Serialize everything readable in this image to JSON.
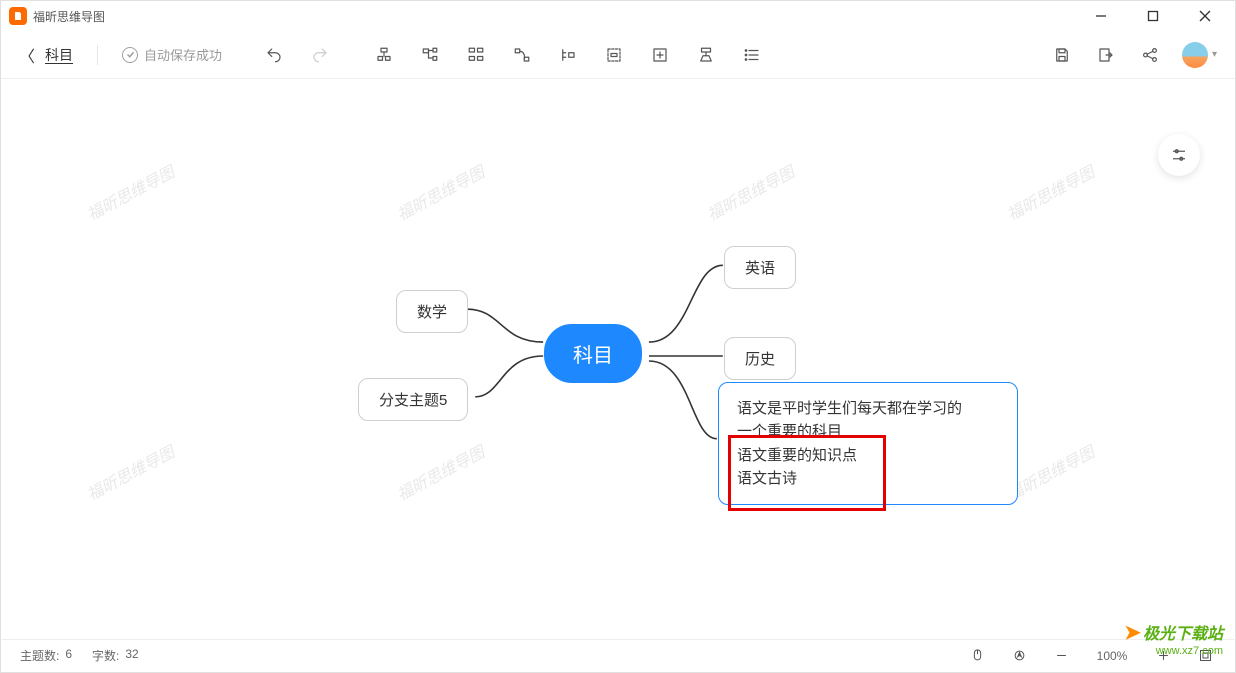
{
  "app": {
    "title": "福昕思维导图"
  },
  "toolbar": {
    "breadcrumb": "科目",
    "autosave_status": "自动保存成功"
  },
  "mindmap": {
    "central": "科目",
    "left_nodes": [
      "数学",
      "分支主题5"
    ],
    "right_nodes": [
      "英语",
      "历史"
    ],
    "note_lines": [
      "语文是平时学生们每天都在学习的",
      "一个重要的科目",
      "语文重要的知识点",
      "语文古诗"
    ]
  },
  "statusbar": {
    "topic_label": "主题数:",
    "topic_count": "6",
    "word_label": "字数:",
    "word_count": "32",
    "zoom": "100%"
  },
  "watermark_text": "福昕思维导图",
  "site": {
    "name": "极光下载站",
    "url": "www.xz7.com"
  }
}
